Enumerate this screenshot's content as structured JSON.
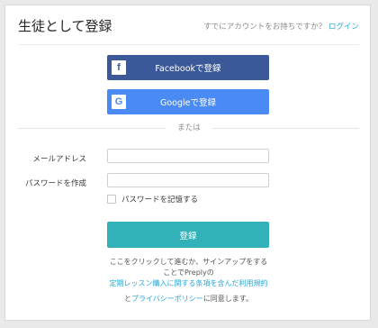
{
  "header": {
    "title": "生徒として登録",
    "login_prompt": "すでにアカウントをお持ちですか？",
    "login_link": "ログイン"
  },
  "social": {
    "facebook_label": "Facebookで登録",
    "facebook_icon": "f",
    "google_label": "Googleで登録",
    "google_icon": "G"
  },
  "divider": {
    "text": "または"
  },
  "form": {
    "email_label": "メールアドレス",
    "email_value": "",
    "password_label": "パスワードを作成",
    "password_value": "",
    "remember_label": "パスワードを記憶する",
    "submit_label": "登録"
  },
  "terms": {
    "line1": "ここをクリックして進むか、サインアップをする",
    "line2": "ことでPreplyの",
    "line3_link": "定期レッスン購入に関する条項を含んだ利用規約",
    "line4_prefix": "と",
    "line4_link": "プライバシーポリシー",
    "line4_suffix": "に同意します。"
  },
  "colors": {
    "facebook": "#3b5998",
    "google": "#4a8af4",
    "submit": "#32b2b8",
    "link": "#2ba6d3"
  }
}
